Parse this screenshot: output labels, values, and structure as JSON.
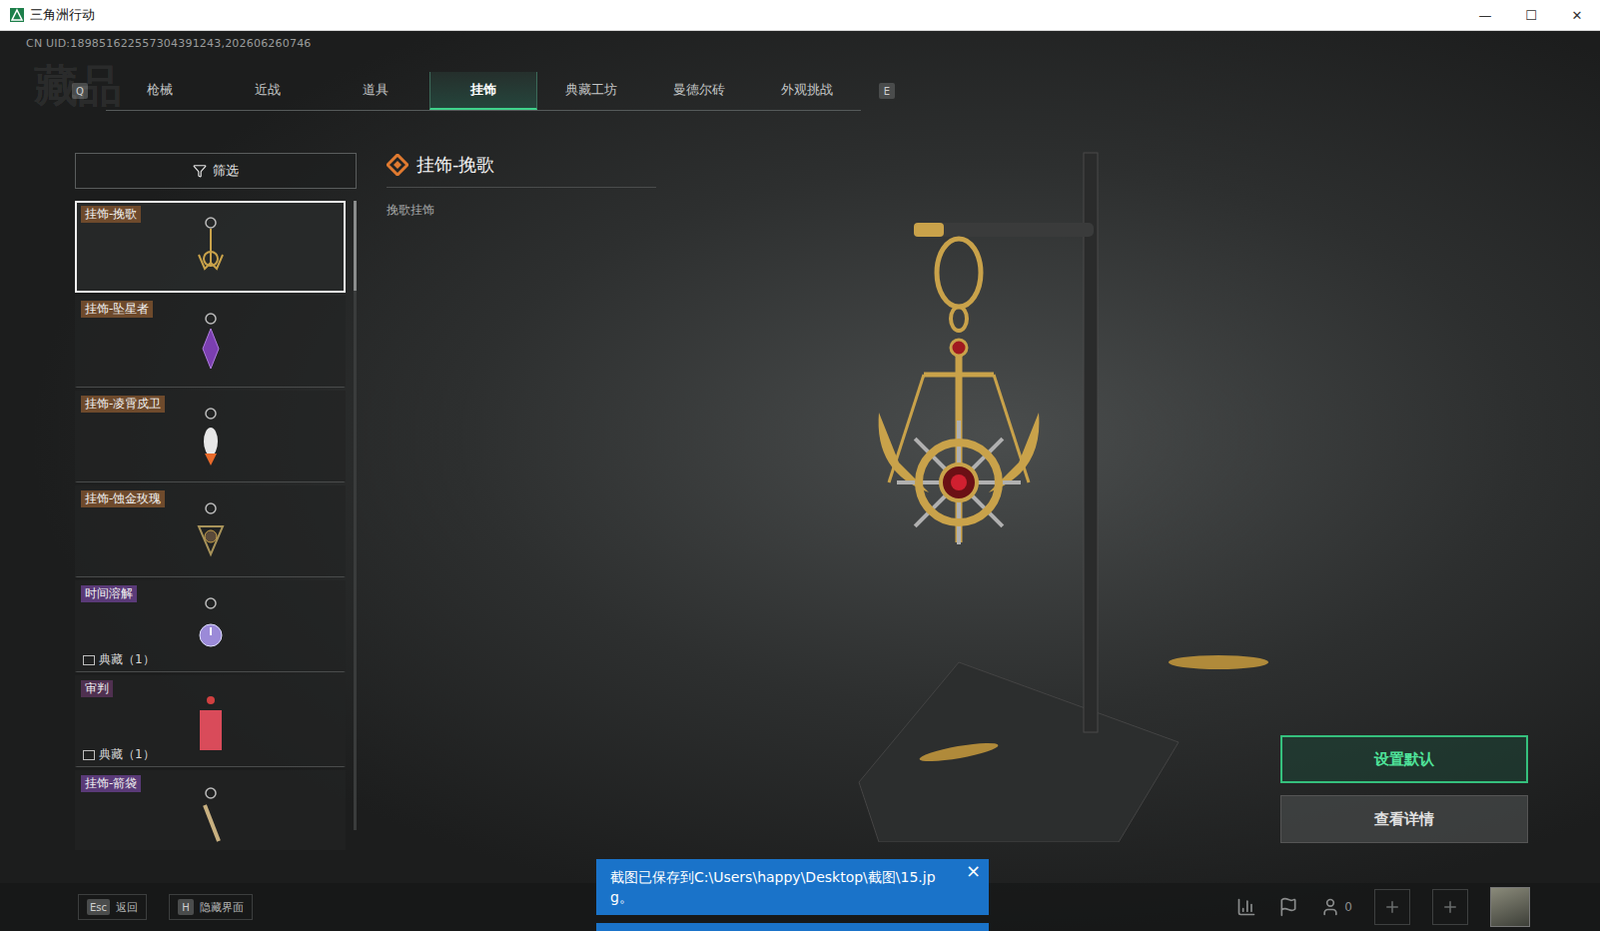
{
  "window": {
    "title": "三角洲行动",
    "controls": [
      "—",
      "☐",
      "✕"
    ]
  },
  "uid": "CN UID:189851622557304391243,202606260746",
  "watermark": "藏品",
  "tabs": {
    "prev_key": "Q",
    "next_key": "E",
    "items": [
      {
        "label": "枪械",
        "selected": false
      },
      {
        "label": "近战",
        "selected": false
      },
      {
        "label": "道具",
        "selected": false
      },
      {
        "label": "挂饰",
        "selected": true
      },
      {
        "label": "典藏工坊",
        "selected": false
      },
      {
        "label": "曼德尔砖",
        "selected": false
      },
      {
        "label": "外观挑战",
        "selected": false
      }
    ]
  },
  "filter": {
    "label": "筛选"
  },
  "items": [
    {
      "name": "挂饰-挽歌",
      "selected": true,
      "color": "#6e4a2c",
      "kind": "anchor"
    },
    {
      "name": "挂饰-坠星者",
      "selected": false,
      "color": "#6e4a2c",
      "kind": "crystal"
    },
    {
      "name": "挂饰-凌霄戍卫",
      "selected": false,
      "color": "#6e4a2c",
      "kind": "rocket"
    },
    {
      "name": "挂饰-蚀金玫瑰",
      "selected": false,
      "color": "#6e4a2c",
      "kind": "rose"
    },
    {
      "name": "时间溶解",
      "selected": false,
      "color": "#5a3a78",
      "kind": "clock",
      "badge": "典藏（1）"
    },
    {
      "name": "审判",
      "selected": false,
      "color": "#4f3050",
      "kind": "card",
      "badge": "典藏（1）"
    },
    {
      "name": "挂饰-箭袋",
      "selected": false,
      "color": "#5a3a78",
      "kind": "quiver"
    }
  ],
  "detail": {
    "title": "挂饰-挽歌",
    "subtitle": "挽歌挂饰"
  },
  "buttons": [
    {
      "label": "设置默认",
      "primary": true
    },
    {
      "label": "查看详情",
      "primary": false
    }
  ],
  "hints": [
    {
      "key": "Esc",
      "label": "返回"
    },
    {
      "key": "H",
      "label": "隐藏界面"
    }
  ],
  "friends_count": "0",
  "toast": {
    "text": "截图已保存到C:\\Users\\happy\\Desktop\\截图\\15.jpg。",
    "close": "×"
  }
}
